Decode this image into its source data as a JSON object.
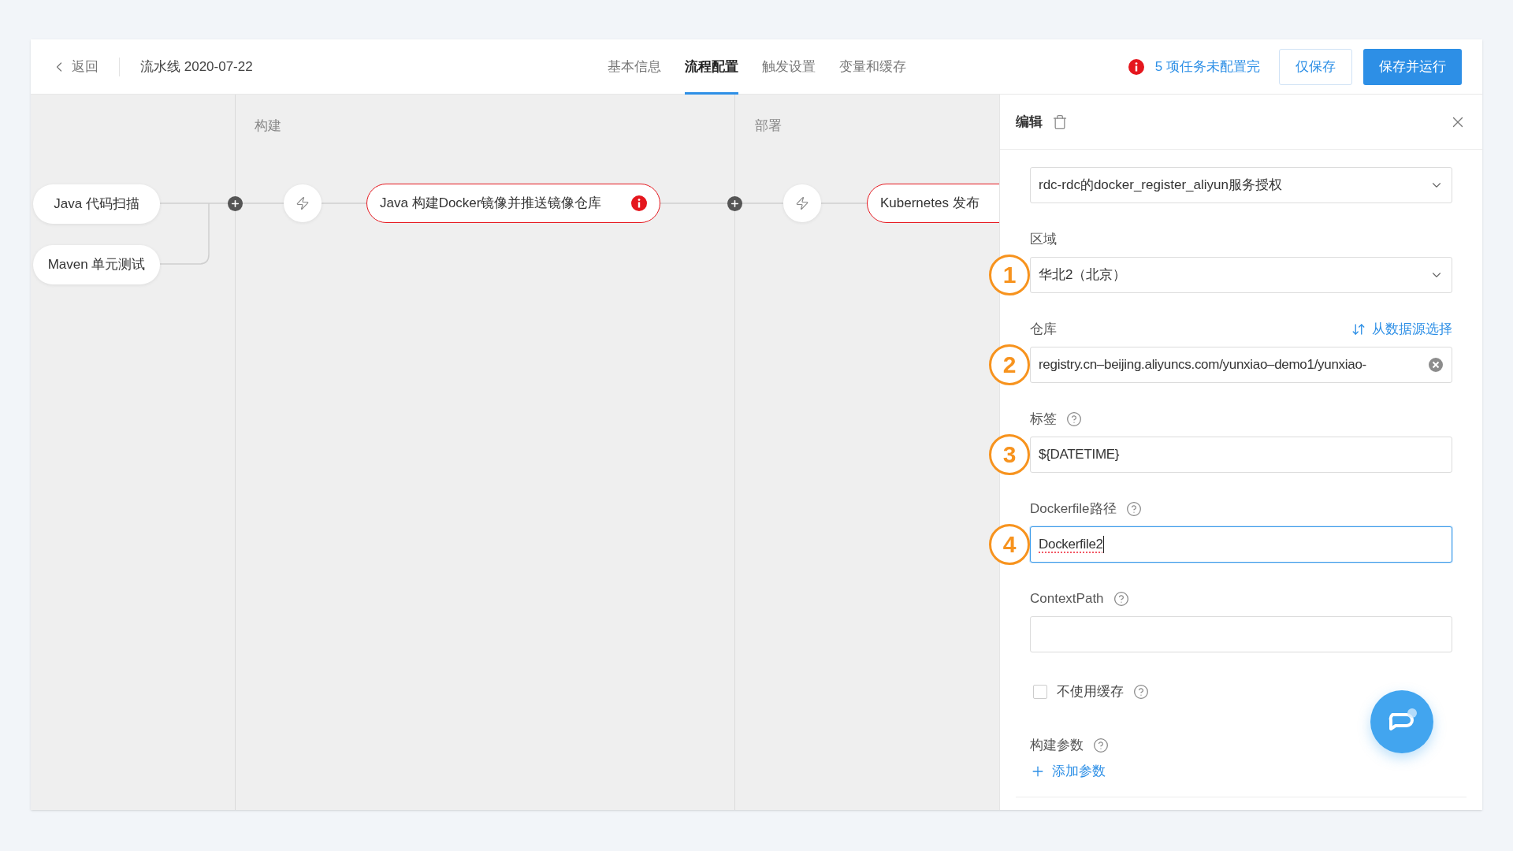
{
  "header": {
    "back_label": "返回",
    "title": "流水线 2020-07-22",
    "tabs": [
      {
        "label": "基本信息",
        "selected": false
      },
      {
        "label": "流程配置",
        "selected": true
      },
      {
        "label": "触发设置",
        "selected": false
      },
      {
        "label": "变量和缓存",
        "selected": false
      }
    ],
    "warning": "5 项任务未配置完",
    "buttons": [
      {
        "label": "仅保存",
        "kind": "secondary"
      },
      {
        "label": "保存并运行",
        "kind": "primary"
      }
    ]
  },
  "canvas": {
    "stages": [
      "构建",
      "部署"
    ],
    "nodes": [
      {
        "label": "Java 代码扫描",
        "alert": false,
        "invalid": false
      },
      {
        "label": "Maven 单元测试",
        "alert": false,
        "invalid": false
      },
      {
        "label": "Java 构建Docker镜像并推送镜像仓库",
        "alert": true,
        "invalid": true
      },
      {
        "label": "Kubernetes 发布",
        "alert": false,
        "invalid": true
      }
    ]
  },
  "panel": {
    "title": "编辑",
    "fields": [
      {
        "kind": "select",
        "value": "rdc-rdc的docker_register_aliyun服务授权"
      },
      {
        "kind": "select",
        "label": "区域",
        "value": "华北2（北京）",
        "callout": "1"
      },
      {
        "kind": "text",
        "label": "仓库",
        "action": "从数据源选择",
        "value": "registry.cn–beijing.aliyuncs.com/yunxiao–demo1/yunxiao-",
        "clearable": true,
        "callout": "2"
      },
      {
        "kind": "text",
        "label": "标签",
        "help": true,
        "value": "${DATETIME}",
        "callout": "3"
      },
      {
        "kind": "text",
        "label": "Dockerfile路径",
        "help": true,
        "value": "Dockerfile2",
        "focused": true,
        "callout": "4"
      },
      {
        "kind": "text",
        "label": "ContextPath",
        "help": true
      },
      {
        "kind": "checkbox",
        "label": "不使用缓存",
        "help": true,
        "checked": false
      },
      {
        "kind": "params",
        "label": "构建参数",
        "help": true,
        "add_label": "添加参数"
      }
    ]
  }
}
